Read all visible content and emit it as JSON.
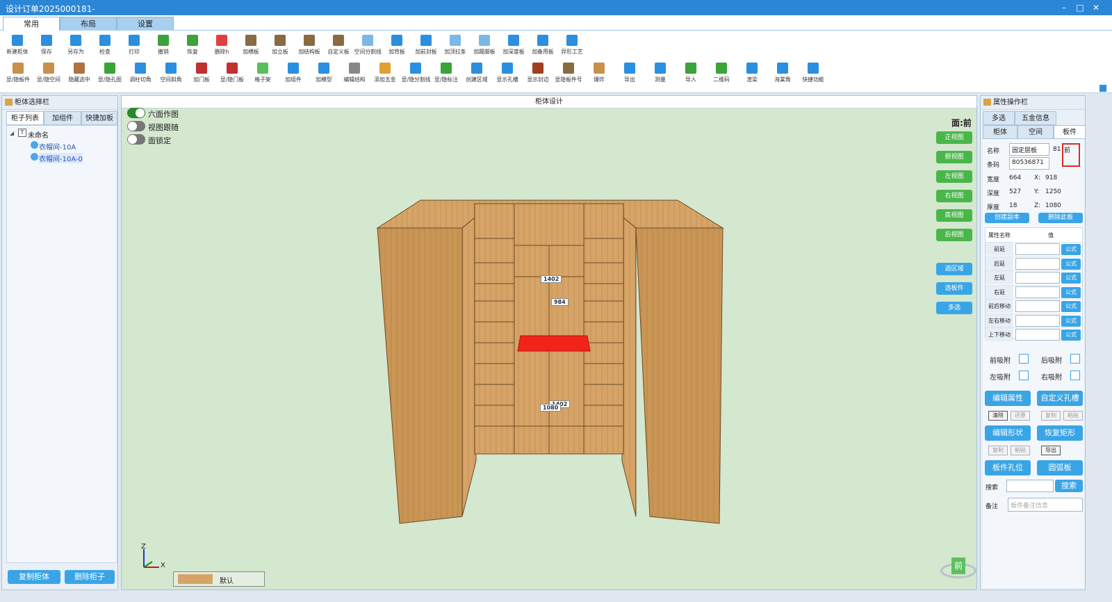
{
  "window": {
    "title": "设计订单2025000181-"
  },
  "ribbon_tabs": [
    "常用",
    "布局",
    "设置"
  ],
  "toolbar_row1": [
    {
      "label": "新建柜体",
      "color": "#2b8fe0"
    },
    {
      "label": "保存",
      "color": "#2b8fe0"
    },
    {
      "label": "另存为",
      "color": "#2b8fe0"
    },
    {
      "label": "检查",
      "color": "#2b8fe0"
    },
    {
      "label": "打印",
      "color": "#2b8fe0"
    },
    {
      "label": "撤销",
      "color": "#3aa33a"
    },
    {
      "label": "恢复",
      "color": "#3aa33a"
    },
    {
      "label": "删除h",
      "color": "#e04040"
    },
    {
      "label": "加横板",
      "color": "#8a6a40"
    },
    {
      "label": "加立板",
      "color": "#8a6a40"
    },
    {
      "label": "加结构板",
      "color": "#8a6a40"
    },
    {
      "label": "自定义板",
      "color": "#8a6a40"
    },
    {
      "label": "空间分割线",
      "color": "#7ab8e8"
    },
    {
      "label": "加背板",
      "color": "#2b8fe0"
    },
    {
      "label": "加前封板",
      "color": "#2b8fe0"
    },
    {
      "label": "加顶拉条",
      "color": "#7ab8e8"
    },
    {
      "label": "加踢脚板",
      "color": "#7ab8e8"
    },
    {
      "label": "加深度板",
      "color": "#2b8fe0"
    },
    {
      "label": "加备用板",
      "color": "#2b8fe0"
    },
    {
      "label": "异形工艺",
      "color": "#2b8fe0"
    }
  ],
  "toolbar_row2": [
    {
      "label": "显/隐板件",
      "color": "#c8904a"
    },
    {
      "label": "显/隐空间",
      "color": "#c8904a"
    },
    {
      "label": "隐藏选中",
      "color": "#b07040"
    },
    {
      "label": "显/隐孔图",
      "color": "#3aa33a"
    },
    {
      "label": "调柱切角",
      "color": "#2b8fe0"
    },
    {
      "label": "空间斜角",
      "color": "#2b8fe0"
    },
    {
      "label": "加门板",
      "color": "#c03030"
    },
    {
      "label": "显/隐门板",
      "color": "#c03030"
    },
    {
      "label": "格子架",
      "color": "#5abf5a"
    },
    {
      "label": "加组件",
      "color": "#2b8fe0"
    },
    {
      "label": "加模型",
      "color": "#2b8fe0"
    },
    {
      "label": "编辑结构",
      "color": "#888"
    },
    {
      "label": "添加五金",
      "color": "#e0a030"
    },
    {
      "label": "显/隐分割线",
      "color": "#2b8fe0"
    },
    {
      "label": "显/隐标注",
      "color": "#3aa33a"
    },
    {
      "label": "创建区域",
      "color": "#2b8fe0"
    },
    {
      "label": "显示孔槽",
      "color": "#2b8fe0"
    },
    {
      "label": "显示封边",
      "color": "#a04020"
    },
    {
      "label": "显隐板件号",
      "color": "#8a6a40"
    },
    {
      "label": "爆炸",
      "color": "#c8904a"
    },
    {
      "label": "导出",
      "color": "#2b8fe0"
    },
    {
      "label": "测量",
      "color": "#2b8fe0"
    },
    {
      "label": "导入",
      "color": "#3aa33a"
    },
    {
      "label": "二维码",
      "color": "#3aa33a"
    },
    {
      "label": "渲染",
      "color": "#2b8fe0"
    },
    {
      "label": "海棠角",
      "color": "#2b8fe0"
    },
    {
      "label": "快捷功能",
      "color": "#2b8fe0"
    }
  ],
  "left_panel": {
    "title": "柜体选择栏",
    "tabs": [
      "柜子列表",
      "加组件",
      "快捷加板"
    ],
    "tree_root": "未命名",
    "tree_items": [
      "衣帽间-10A",
      "衣帽间-10A-0"
    ],
    "copy_button": "复制柜体",
    "delete_button": "删除柜子"
  },
  "center": {
    "title": "柜体设计",
    "toggles": [
      {
        "label": "六面作图",
        "on": true
      },
      {
        "label": "视图跟随",
        "on": false
      },
      {
        "label": "面锁定",
        "on": false
      }
    ],
    "face_label": "面:前",
    "view_buttons": [
      "正视图",
      "俯视图",
      "左视图",
      "右视图",
      "底视图",
      "后视图"
    ],
    "select_buttons": [
      "选区域",
      "选板件",
      "多选"
    ],
    "dimensions": [
      "1402",
      "984",
      "1080",
      "1402"
    ],
    "material_name": "默认",
    "axis": {
      "z": "Z",
      "x": "X"
    },
    "nav_cube_label": "前"
  },
  "right_panel": {
    "title": "属性操作栏",
    "tabs_row1": [
      "多选",
      "五金信息"
    ],
    "tabs_row2": [
      "柜体",
      "空间",
      "板件"
    ],
    "name_label": "名称",
    "name_value": "固定层板",
    "name_suffix": "81",
    "face_tag": "前",
    "code_label": "条码",
    "code_value": "80536871",
    "dims": [
      {
        "k": "宽度",
        "v": "664",
        "ak": "X:",
        "av": "918"
      },
      {
        "k": "深度",
        "v": "527",
        "ak": "Y:",
        "av": "1250"
      },
      {
        "k": "厚度",
        "v": "18",
        "ak": "Z:",
        "av": "1080"
      }
    ],
    "create_copy": "创建副本",
    "delete_board": "删除此板",
    "grid_header": {
      "name": "属性名称",
      "value": "值"
    },
    "grid_rows": [
      "前延",
      "后延",
      "左延",
      "右延",
      "前后移动",
      "左右移动",
      "上下移动"
    ],
    "formula_label": "公式",
    "snaps": [
      {
        "label": "前吸附"
      },
      {
        "label": "后吸附"
      },
      {
        "label": "左吸附"
      },
      {
        "label": "右吸附"
      }
    ],
    "edit_props": "编辑属性",
    "custom_groove": "自定义孔槽",
    "small_row1": [
      "清除",
      "还原",
      "复制",
      "粘贴"
    ],
    "edit_shape": "编辑形状",
    "restore_rect": "恢复矩形",
    "small_row2": [
      "复制",
      "粘贴",
      "导出"
    ],
    "board_holes": "板件孔位",
    "arc_board": "圆弧板",
    "search_label": "搜索",
    "search_button": "搜索",
    "note_label": "备注",
    "note_placeholder": "板件备注信息"
  }
}
